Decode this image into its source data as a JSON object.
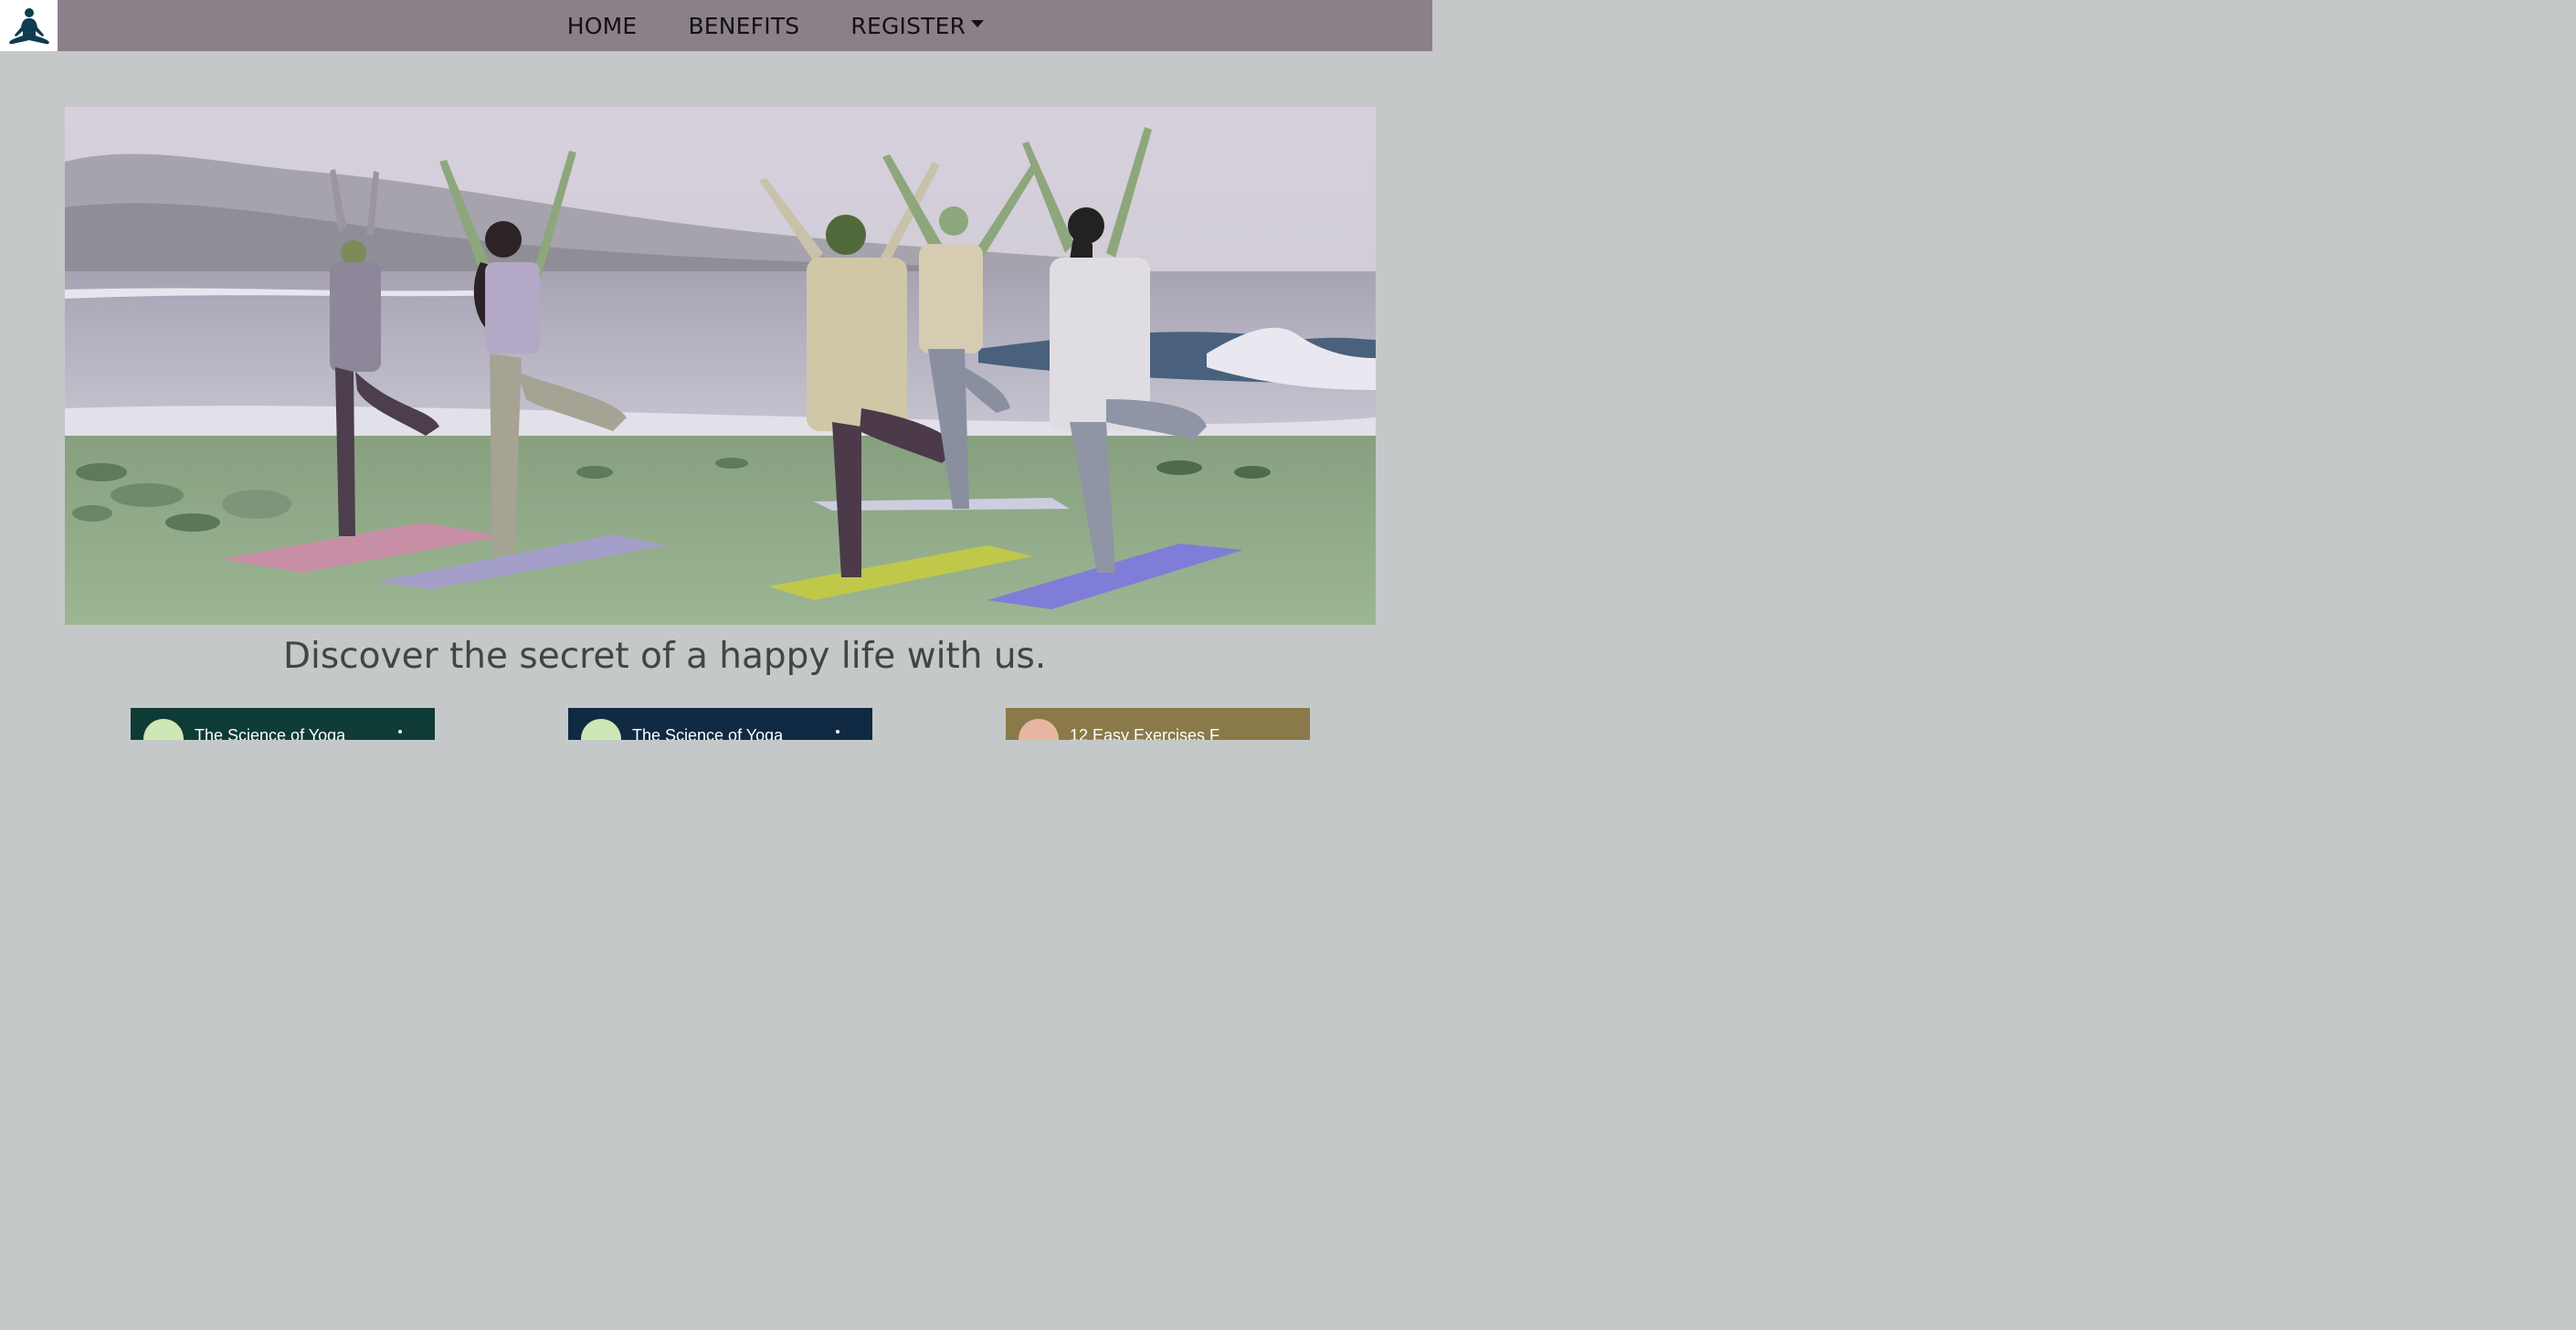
{
  "nav": {
    "logo_icon": "meditation-icon",
    "items": [
      {
        "label": "HOME"
      },
      {
        "label": "BENEFITS"
      },
      {
        "label": "REGISTER",
        "has_dropdown": true
      }
    ]
  },
  "hero": {
    "image_subject": "group-yoga-tree-pose-on-beach"
  },
  "tagline": "Discover the secret of a happy life with us.",
  "videos": [
    {
      "title": "The Science of Yoga",
      "overlay_text": "The science of"
    },
    {
      "title": "The Science of Yoga"
    },
    {
      "title": "12 Easy Exercises F",
      "overlay_text": "12 EASY"
    }
  ],
  "colors": {
    "background": "#c5c8c8",
    "navbar": "#8b8089",
    "tagline": "#444444"
  }
}
